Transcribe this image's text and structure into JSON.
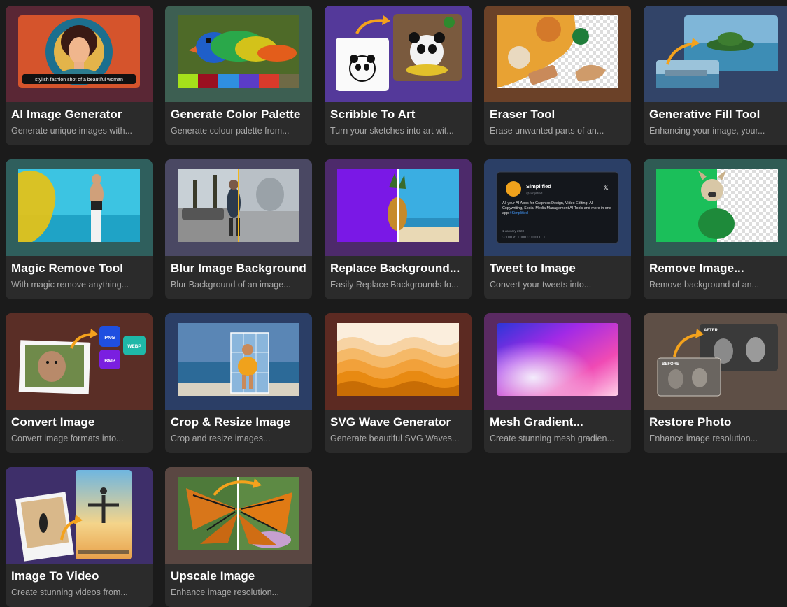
{
  "tools": [
    {
      "title": "AI Image Generator",
      "desc": "Generate unique images with...",
      "color": "#5a2735",
      "icon": "ai-portrait-illustration",
      "caption": "stylish fashion shot of a beautiful woman"
    },
    {
      "title": "Generate Color Palette",
      "desc": "Generate colour palette from...",
      "color": "#3d5f52",
      "icon": "parrot-palette-illustration"
    },
    {
      "title": "Scribble To Art",
      "desc": "Turn your sketches into art wit...",
      "color": "#54399a",
      "icon": "panda-sketch-illustration"
    },
    {
      "title": "Eraser Tool",
      "desc": "Erase unwanted parts of an...",
      "color": "#6b4128",
      "icon": "food-eraser-illustration"
    },
    {
      "title": "Generative Fill Tool",
      "desc": "Enhancing your image, your...",
      "color": "#324468",
      "icon": "island-fill-illustration"
    },
    {
      "title": "Magic Remove Tool",
      "desc": "With magic remove anything...",
      "color": "#2f5f5d",
      "icon": "beach-remove-illustration"
    },
    {
      "title": "Blur Image Background",
      "desc": "Blur Background of an image...",
      "color": "#4a4863",
      "icon": "street-blur-illustration"
    },
    {
      "title": "Replace Background...",
      "desc": "Easily Replace Backgrounds fo...",
      "color": "#4d2a6b",
      "icon": "pineapple-replace-illustration"
    },
    {
      "title": "Tweet to Image",
      "desc": "Convert your tweets into...",
      "color": "#2b3f66",
      "icon": "tweet-card-illustration",
      "tweet": {
        "name": "Simplified",
        "handle": "@simplified",
        "body": "All your AI Apps for Graphics Design, Video Editing, AI Copywriting, Social Media Management AI Tools and more in one app",
        "tag": "#Simplified",
        "date": "1 January 2023",
        "stats": "♡100   ⟲ 1000   ♡10000   ⇩"
      }
    },
    {
      "title": "Remove Image...",
      "desc": "Remove background of an...",
      "color": "#2f5b54",
      "icon": "dog-remove-illustration"
    },
    {
      "title": "Convert Image",
      "desc": "Convert image formats into...",
      "color": "#5a2e26",
      "icon": "format-convert-illustration",
      "formats": [
        "PNG",
        "WEBP",
        "BMP"
      ]
    },
    {
      "title": "Crop & Resize Image",
      "desc": "Crop and resize images...",
      "color": "#2b3e66",
      "icon": "crop-resize-illustration"
    },
    {
      "title": "SVG Wave Generator",
      "desc": "Generate beautiful SVG Waves...",
      "color": "#5c2a22",
      "icon": "svg-wave-illustration"
    },
    {
      "title": "Mesh Gradient...",
      "desc": "Create stunning mesh gradien...",
      "color": "#5a2a62",
      "icon": "mesh-gradient-illustration"
    },
    {
      "title": "Restore Photo",
      "desc": "Enhance image resolution...",
      "color": "#5e4f46",
      "icon": "restore-photo-illustration",
      "labels": [
        "AFTER",
        "BEFORE"
      ]
    },
    {
      "title": "Image To Video",
      "desc": "Create stunning videos from...",
      "color": "#3e2f6a",
      "icon": "image-video-illustration"
    },
    {
      "title": "Upscale Image",
      "desc": "Enhance image resolution...",
      "color": "#5a4742",
      "icon": "butterfly-upscale-illustration"
    }
  ]
}
